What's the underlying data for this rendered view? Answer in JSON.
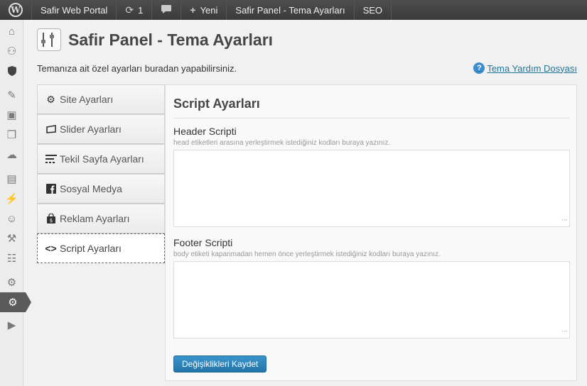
{
  "adminbar": {
    "site_name": "Safir Web Portal",
    "updates_count": "1",
    "new_label": "Yeni",
    "panel_label": "Safir Panel - Tema Ayarları",
    "seo_label": "SEO"
  },
  "header": {
    "title": "Safir Panel - Tema Ayarları",
    "intro": "Temanıza ait özel ayarları buradan yapabilirsiniz.",
    "help_link": "Tema Yardım Dosyası"
  },
  "tabs": [
    {
      "label": "Site Ayarları",
      "icon": "gear-icon"
    },
    {
      "label": "Slider Ayarları",
      "icon": "slider-icon"
    },
    {
      "label": "Tekil Sayfa Ayarları",
      "icon": "lines-icon"
    },
    {
      "label": "Sosyal Medya",
      "icon": "facebook-icon"
    },
    {
      "label": "Reklam Ayarları",
      "icon": "bag-icon"
    },
    {
      "label": "Script Ayarları",
      "icon": "code-icon"
    }
  ],
  "active_tab": "Script Ayarları",
  "content": {
    "section_title": "Script Ayarları",
    "header_script": {
      "label": "Header Scripti",
      "description": "head etiketleri arasına yerleştirmek istediğiniz kodları buraya yazınız.",
      "value": ""
    },
    "footer_script": {
      "label": "Footer Scripti",
      "description": "body etiketi kapanmadan hemen önce yerleştirmek istediğiniz kodları buraya yazınız.",
      "value": ""
    },
    "save_label": "Değişiklikleri Kaydet"
  },
  "colors": {
    "adminbar_bg": "#464646",
    "primary_button": "#2e84ba",
    "link": "#21759b"
  }
}
